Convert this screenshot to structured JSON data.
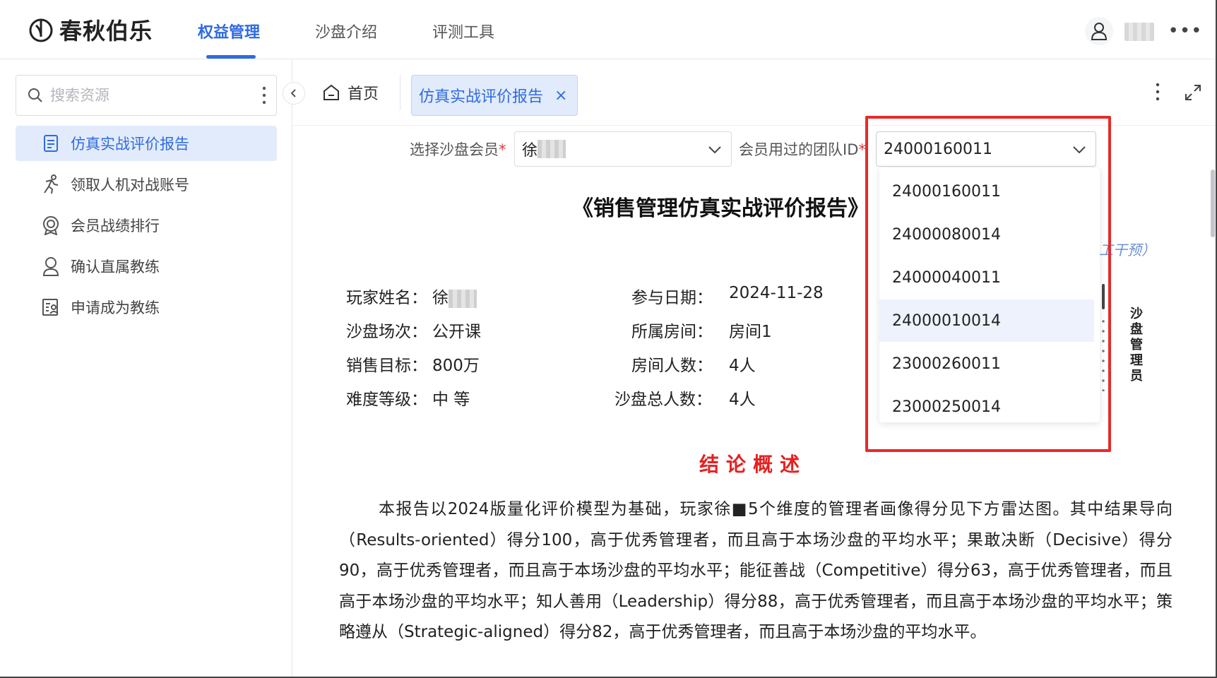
{
  "brand": {
    "name": "春秋伯乐"
  },
  "topnav": {
    "tabs": [
      {
        "label": "权益管理",
        "active": true
      },
      {
        "label": "沙盘介绍",
        "active": false
      },
      {
        "label": "评测工具",
        "active": false
      }
    ],
    "icons": [
      "user-icon",
      "more-icon"
    ]
  },
  "sidebar": {
    "search_placeholder": "搜索资源",
    "items": [
      {
        "label": "仿真实战评价报告",
        "icon": "document-icon",
        "active": true
      },
      {
        "label": "领取人机对战账号",
        "icon": "running-person-icon",
        "active": false
      },
      {
        "label": "会员战绩排行",
        "icon": "medal-icon",
        "active": false
      },
      {
        "label": "确认直属教练",
        "icon": "person-icon",
        "active": false
      },
      {
        "label": "申请成为教练",
        "icon": "application-form-icon",
        "active": false
      }
    ]
  },
  "tabs": {
    "home_label": "首页",
    "active_tab_label": "仿真实战评价报告",
    "close_symbol": "×"
  },
  "filters": {
    "member_label": "选择沙盘会员",
    "member_value_prefix": "徐",
    "team_label": "会员用过的团队ID",
    "team_value": "24000160011",
    "required_mark": "*"
  },
  "dropdown": {
    "options": [
      "24000160011",
      "24000080014",
      "24000040011",
      "24000010014",
      "23000260011",
      "23000250014"
    ],
    "hovered": "24000010014"
  },
  "report": {
    "title": "《销售管理仿真实战评价报告》",
    "hint": "工干预）",
    "side_label": "沙盘管理员",
    "info": {
      "player_name_label": "玩家姓名：",
      "player_name_value": "徐",
      "session_label": "沙盘场次：",
      "session_value": "公开课",
      "target_label": "销售目标：",
      "target_value": "800万",
      "difficulty_label": "难度等级：",
      "difficulty_value": "中 等",
      "date_label": "参与日期：",
      "date_value": "2024-11-28",
      "room_label": "所属房间：",
      "room_value": "房间1",
      "room_count_label": "房间人数：",
      "room_count_value": "4人",
      "total_label": "沙盘总人数：",
      "total_value": "4人"
    },
    "section_title": "结论概述",
    "paragraph": "本报告以2024版量化评价模型为基础，玩家徐■5个维度的管理者画像得分见下方雷达图。其中结果导向（Results-oriented）得分100，高于优秀管理者，而且高于本场沙盘的平均水平；果敢决断（Decisive）得分90，高于优秀管理者，而且高于本场沙盘的平均水平；能征善战（Competitive）得分63，高于优秀管理者，而且高于本场沙盘的平均水平；知人善用（Leadership）得分88，高于优秀管理者，而且高于本场沙盘的平均水平；策略遵从（Strategic-aligned）得分82，高于优秀管理者，而且高于本场沙盘的平均水平。"
  },
  "colors": {
    "accent": "#2f6be0",
    "highlight": "#e52b2b",
    "section": "#e52020"
  }
}
